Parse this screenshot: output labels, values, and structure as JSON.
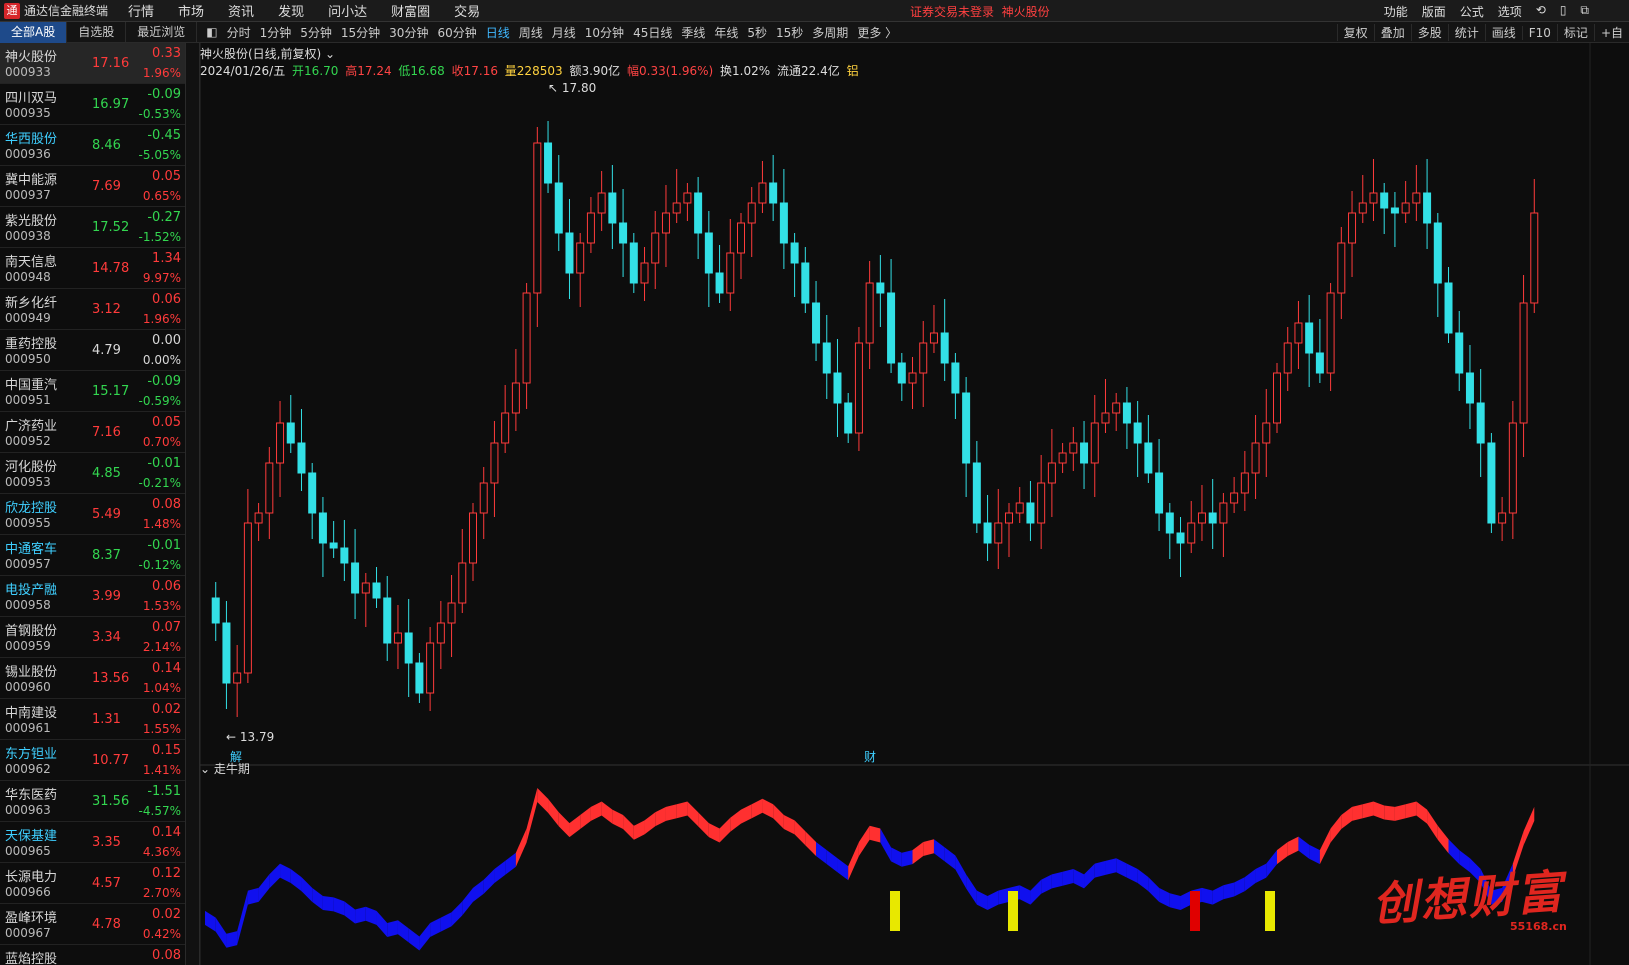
{
  "app": {
    "title": "通达信金融终端",
    "menus": [
      "行情",
      "市场",
      "资讯",
      "发现",
      "问小达",
      "财富圈",
      "交易"
    ],
    "warning": "证券交易未登录",
    "current_stock": "神火股份",
    "right_menus": [
      "功能",
      "版面",
      "公式",
      "选项"
    ]
  },
  "list_tabs": [
    "全部A股",
    "自选股",
    "最近浏览"
  ],
  "periods": [
    "分时",
    "1分钟",
    "5分钟",
    "15分钟",
    "30分钟",
    "60分钟",
    "日线",
    "周线",
    "月线",
    "10分钟",
    "45日线",
    "季线",
    "年线",
    "5秒",
    "15秒",
    "多周期",
    "更多 〉"
  ],
  "active_period": "日线",
  "tools": [
    "复权",
    "叠加",
    "多股",
    "统计",
    "画线",
    "F10",
    "标记",
    "+自"
  ],
  "stocks": [
    {
      "name": "神火股份",
      "code": "000933",
      "price": "17.16",
      "chg": "0.33",
      "pct": "1.96%",
      "dir": "up",
      "cyan": false
    },
    {
      "name": "四川双马",
      "code": "000935",
      "price": "16.97",
      "chg": "-0.09",
      "pct": "-0.53%",
      "dir": "dn",
      "cyan": false
    },
    {
      "name": "华西股份",
      "code": "000936",
      "price": "8.46",
      "chg": "-0.45",
      "pct": "-5.05%",
      "dir": "dn",
      "cyan": true
    },
    {
      "name": "冀中能源",
      "code": "000937",
      "price": "7.69",
      "chg": "0.05",
      "pct": "0.65%",
      "dir": "up",
      "cyan": false
    },
    {
      "name": "紫光股份",
      "code": "000938",
      "price": "17.52",
      "chg": "-0.27",
      "pct": "-1.52%",
      "dir": "dn",
      "cyan": false
    },
    {
      "name": "南天信息",
      "code": "000948",
      "price": "14.78",
      "chg": "1.34",
      "pct": "9.97%",
      "dir": "up",
      "cyan": false
    },
    {
      "name": "新乡化纤",
      "code": "000949",
      "price": "3.12",
      "chg": "0.06",
      "pct": "1.96%",
      "dir": "up",
      "cyan": false
    },
    {
      "name": "重药控股",
      "code": "000950",
      "price": "4.79",
      "chg": "0.00",
      "pct": "0.00%",
      "dir": "flat",
      "cyan": false
    },
    {
      "name": "中国重汽",
      "code": "000951",
      "price": "15.17",
      "chg": "-0.09",
      "pct": "-0.59%",
      "dir": "dn",
      "cyan": false
    },
    {
      "name": "广济药业",
      "code": "000952",
      "price": "7.16",
      "chg": "0.05",
      "pct": "0.70%",
      "dir": "up",
      "cyan": false
    },
    {
      "name": "河化股份",
      "code": "000953",
      "price": "4.85",
      "chg": "-0.01",
      "pct": "-0.21%",
      "dir": "dn",
      "cyan": false
    },
    {
      "name": "欣龙控股",
      "code": "000955",
      "price": "5.49",
      "chg": "0.08",
      "pct": "1.48%",
      "dir": "up",
      "cyan": true
    },
    {
      "name": "中通客车",
      "code": "000957",
      "price": "8.37",
      "chg": "-0.01",
      "pct": "-0.12%",
      "dir": "dn",
      "cyan": true
    },
    {
      "name": "电投产融",
      "code": "000958",
      "price": "3.99",
      "chg": "0.06",
      "pct": "1.53%",
      "dir": "up",
      "cyan": true
    },
    {
      "name": "首钢股份",
      "code": "000959",
      "price": "3.34",
      "chg": "0.07",
      "pct": "2.14%",
      "dir": "up",
      "cyan": false
    },
    {
      "name": "锡业股份",
      "code": "000960",
      "price": "13.56",
      "chg": "0.14",
      "pct": "1.04%",
      "dir": "up",
      "cyan": false
    },
    {
      "name": "中南建设",
      "code": "000961",
      "price": "1.31",
      "chg": "0.02",
      "pct": "1.55%",
      "dir": "up",
      "cyan": false
    },
    {
      "name": "东方钽业",
      "code": "000962",
      "price": "10.77",
      "chg": "0.15",
      "pct": "1.41%",
      "dir": "up",
      "cyan": true
    },
    {
      "name": "华东医药",
      "code": "000963",
      "price": "31.56",
      "chg": "-1.51",
      "pct": "-4.57%",
      "dir": "dn",
      "cyan": false
    },
    {
      "name": "天保基建",
      "code": "000965",
      "price": "3.35",
      "chg": "0.14",
      "pct": "4.36%",
      "dir": "up",
      "cyan": true
    },
    {
      "name": "长源电力",
      "code": "000966",
      "price": "4.57",
      "chg": "0.12",
      "pct": "2.70%",
      "dir": "up",
      "cyan": false
    },
    {
      "name": "盈峰环境",
      "code": "000967",
      "price": "4.78",
      "chg": "0.02",
      "pct": "0.42%",
      "dir": "up",
      "cyan": false
    },
    {
      "name": "蓝焰控股",
      "code": "",
      "price": "",
      "chg": "0.08",
      "pct": "",
      "dir": "up",
      "cyan": false
    }
  ],
  "chart": {
    "title": "神火股份(日线,前复权)",
    "date": "2024/01/26/五",
    "open_label": "开16.70",
    "high_label": "高17.24",
    "low_label": "低16.68",
    "close_label": "收17.16",
    "vol_label": "量228503",
    "amt_label": "额3.90亿",
    "chg_label": "幅0.33(1.96%)",
    "turnover_label": "换1.02%",
    "float_label": "流通22.4亿",
    "sector_label": "铝",
    "max_label": "17.80",
    "min_label": "13.79",
    "marker_jie": "解",
    "marker_cai": "财",
    "indicator_title": "走牛期"
  },
  "watermark": {
    "text": "创想财富",
    "url": "55168.cn"
  },
  "colors": {
    "up": "#ff3b3b",
    "down": "#33e0e6",
    "ribbon_up": "#ff3030",
    "ribbon_down": "#1010ee"
  }
}
